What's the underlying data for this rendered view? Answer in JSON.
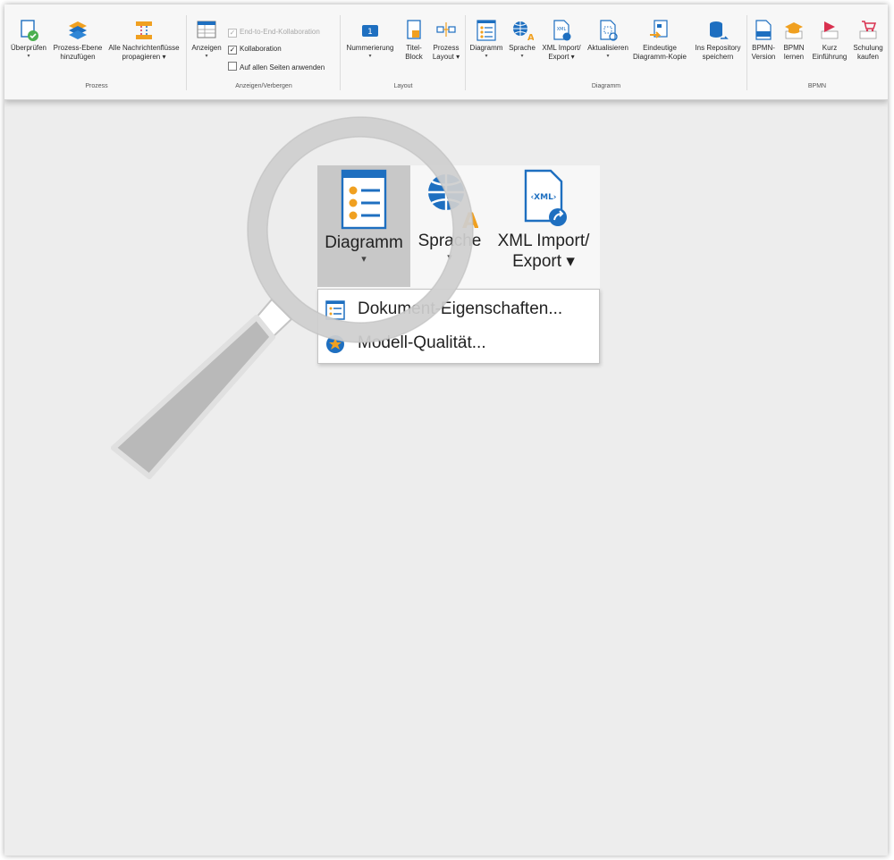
{
  "ribbon": {
    "groups": {
      "prozess": "Prozess",
      "anzeigen": "Anzeigen/Verbergen",
      "layout": "Layout",
      "diagramm": "Diagramm",
      "bpmn": "BPMN"
    },
    "buttons": {
      "ueberpruefen": {
        "label": "Überprüfen",
        "caret": "▾"
      },
      "prozess_ebene": {
        "label1": "Prozess-Ebene",
        "label2": "hinzufügen"
      },
      "nachrichtenfluesse": {
        "label1": "Alle Nachrichtenflüsse",
        "label2": "propagieren ▾"
      },
      "anzeigen": {
        "label": "Anzeigen",
        "caret": "▾"
      },
      "nummerierung": {
        "label": "Nummerierung",
        "caret": "▾"
      },
      "titel_block": {
        "label1": "Titel-",
        "label2": "Block"
      },
      "prozess_layout": {
        "label1": "Prozess",
        "label2": "Layout ▾"
      },
      "diagramm": {
        "label": "Diagramm",
        "caret": "▾"
      },
      "sprache": {
        "label": "Sprache",
        "caret": "▾"
      },
      "xml": {
        "label1": "XML Import/",
        "label2": "Export ▾"
      },
      "aktualisieren": {
        "label": "Aktualisieren",
        "caret": "▾"
      },
      "eindeutige": {
        "label1": "Eindeutige",
        "label2": "Diagramm-Kopie"
      },
      "repository": {
        "label1": "Ins Repository",
        "label2": "speichern"
      },
      "bpmn_version": {
        "label1": "BPMN-",
        "label2": "Version"
      },
      "bpmn_lernen": {
        "label1": "BPMN",
        "label2": "lernen"
      },
      "kurz": {
        "label1": "Kurz",
        "label2": "Einführung"
      },
      "schulung": {
        "label1": "Schulung",
        "label2": "kaufen"
      }
    },
    "checkboxes": {
      "e2e": {
        "label": "End-to-End-Kollaboration",
        "check": "✓"
      },
      "kollaboration": {
        "label": "Kollaboration",
        "check": "✓"
      },
      "alle_seiten": {
        "label": "Auf allen Seiten anwenden",
        "check": ""
      }
    }
  },
  "zoom": {
    "diagramm": {
      "label": "Diagramm",
      "caret": "▾"
    },
    "sprache": {
      "label": "Sprache",
      "caret": "▾"
    },
    "xml": {
      "label1": "XML Import/",
      "label2": "Export ▾"
    }
  },
  "menu": {
    "items": [
      {
        "label": "Dokument-Eigenschaften..."
      },
      {
        "label": "Modell-Qualität..."
      }
    ]
  },
  "colors": {
    "accent": "#1e6fc0",
    "highlight": "#f0a020",
    "menu_selected": "#c8c8c8"
  }
}
